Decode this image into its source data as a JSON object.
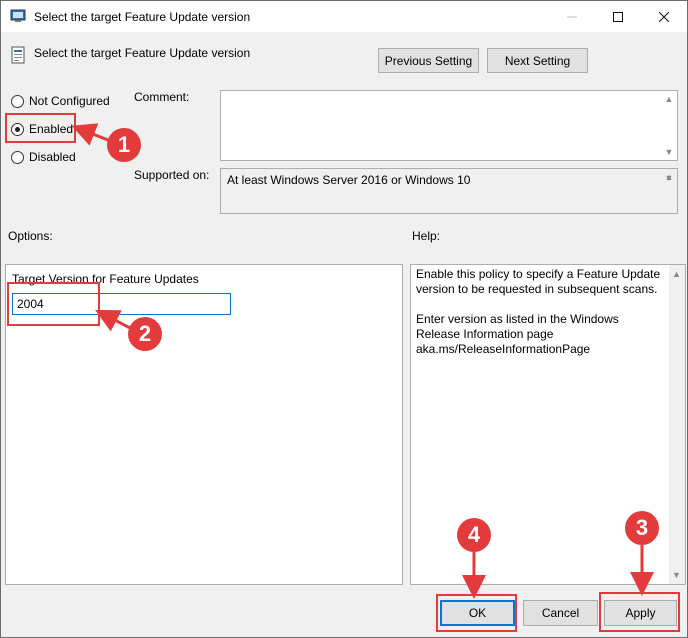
{
  "window": {
    "title": "Select the target Feature Update version",
    "minimize_icon": "minimize-icon",
    "maximize_icon": "maximize-icon",
    "close_icon": "close-icon"
  },
  "header": {
    "policy_name": "Select the target Feature Update version",
    "prev_label": "Previous Setting",
    "next_label": "Next Setting"
  },
  "state": {
    "options": [
      {
        "label": "Not Configured",
        "checked": false
      },
      {
        "label": "Enabled",
        "checked": true
      },
      {
        "label": "Disabled",
        "checked": false
      }
    ]
  },
  "comment": {
    "label": "Comment:",
    "value": ""
  },
  "supported": {
    "label": "Supported on:",
    "value": "At least Windows Server 2016 or Windows 10"
  },
  "options": {
    "label": "Options:",
    "field_label": "Target Version for Feature Updates",
    "field_value": "2004"
  },
  "help": {
    "label": "Help:",
    "para1": "Enable this policy to specify a Feature Update version to be requested in subsequent scans.",
    "para2": "Enter version as listed in the Windows Release Information page aka.ms/ReleaseInformationPage"
  },
  "footer": {
    "ok_label": "OK",
    "cancel_label": "Cancel",
    "apply_label": "Apply"
  },
  "annotations": {
    "step1": "1",
    "step2": "2",
    "step3": "3",
    "step4": "4",
    "color": "#e33b3b"
  }
}
